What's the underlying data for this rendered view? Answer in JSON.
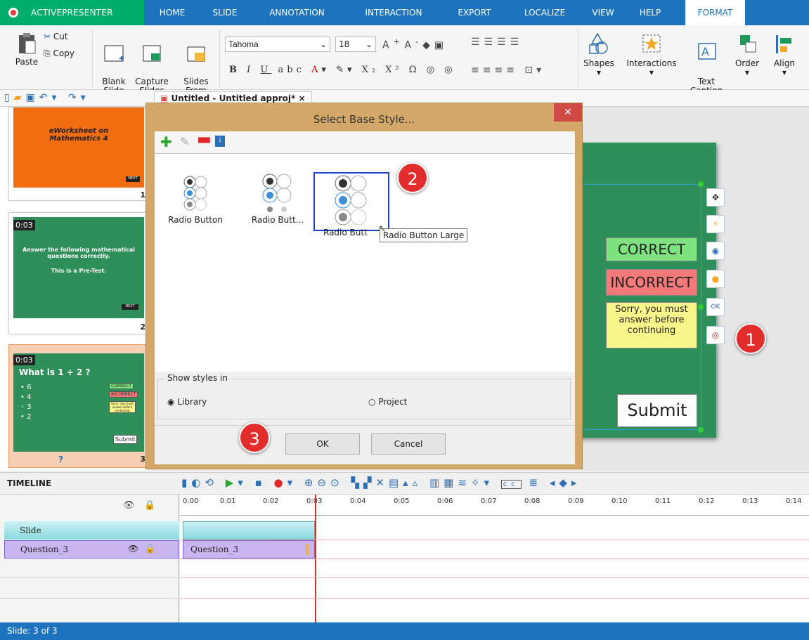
{
  "app": {
    "name": "ACTIVEPRESENTER"
  },
  "menu_tabs": [
    "HOME",
    "SLIDE",
    "ANNOTATION",
    "INTERACTION",
    "EXPORT",
    "LOCALIZE",
    "VIEW",
    "HELP",
    "FORMAT"
  ],
  "ribbon": {
    "cut": "Cut",
    "copy": "Copy",
    "paste": "Paste",
    "blank_slide": "Blank\nSlide",
    "capture_slides": "Capture\nSlides",
    "slides_from": "Slides\nFrom",
    "font_name": "Tahoma",
    "font_size": "18",
    "shapes": "Shapes",
    "interactions": "Interactions",
    "text_caption": "Text\nCaption",
    "order": "Order",
    "align": "Align"
  },
  "document_tab": "Untitled - Untitled approj* ×",
  "slides": [
    {
      "title": "eWorksheet on Mathematics 4",
      "number": "1",
      "next": "NEXT"
    },
    {
      "time": "0:03",
      "text1": "Answer the following mathematical questions correctly.",
      "text2": "This is a Pre-Test.",
      "number": "2",
      "next": "NEXT"
    },
    {
      "time": "0:03",
      "question": "What is 1 + 2 ?",
      "options": [
        "6",
        "4",
        "3",
        "2"
      ],
      "correct": "CORRECT",
      "incorrect": "INCORRECT",
      "sorry": "Sorry, you must answer before continuing",
      "submit": "Submit",
      "number": "3",
      "mark": "?"
    }
  ],
  "canvas": {
    "correct": "CORRECT",
    "incorrect": "INCORRECT",
    "sorry": "Sorry, you must answer before continuing",
    "submit": "Submit",
    "ok_icon": "OK"
  },
  "badges": [
    "1",
    "2",
    "3"
  ],
  "dialog": {
    "title": "Select Base Style...",
    "styles": [
      "Radio Button",
      "Radio Butt...",
      "Radio Butt"
    ],
    "tooltip": "Radio Button Large",
    "show_styles_in": "Show styles in",
    "library": "Library",
    "project": "Project",
    "ok": "OK",
    "cancel": "Cancel"
  },
  "timeline": {
    "label": "TIMELINE",
    "ticks": [
      "0:00",
      "0:01",
      "0:02",
      "0:03",
      "0:04",
      "0:05",
      "0:06",
      "0:07",
      "0:08",
      "0:09",
      "0:10",
      "0:11",
      "0:12",
      "0:13",
      "0:14"
    ],
    "rows": [
      "Slide",
      "Question_3"
    ],
    "clip": "Question_3"
  },
  "status": "Slide: 3 of 3"
}
